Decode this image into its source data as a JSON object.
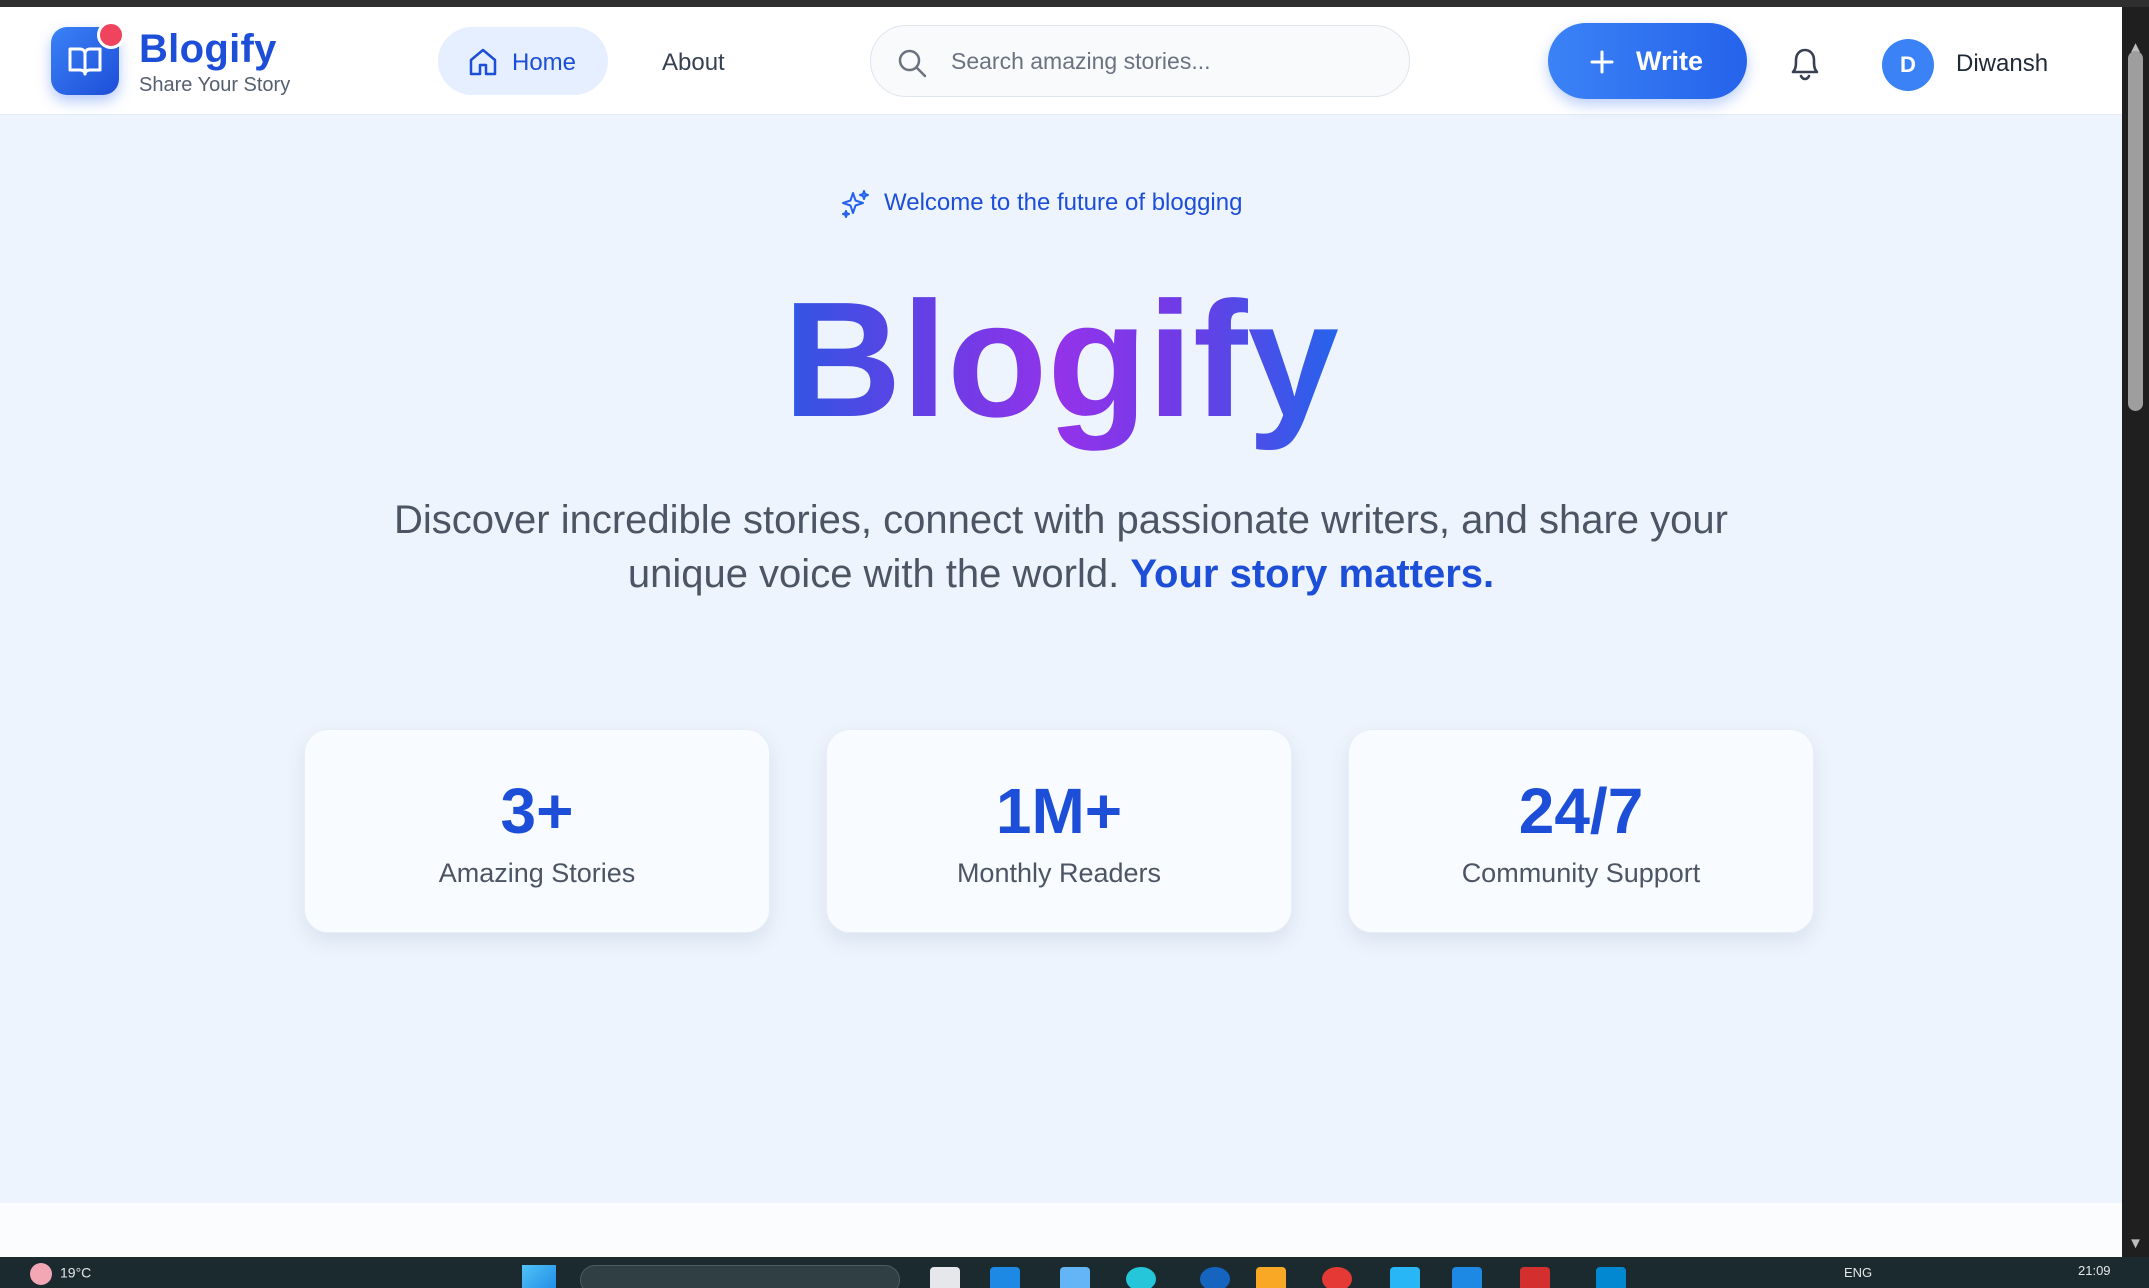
{
  "header": {
    "brand_name": "Blogify",
    "brand_tagline": "Share Your Story",
    "nav": {
      "home_label": "Home",
      "about_label": "About"
    },
    "search": {
      "placeholder": "Search amazing stories...",
      "value": ""
    },
    "write_label": "Write",
    "user": {
      "initial": "D",
      "name": "Diwansh"
    }
  },
  "hero": {
    "badge_text": "Welcome to the future of blogging",
    "title": "Blogify",
    "subtitle_line1": "Discover incredible stories, connect with passionate writers, and share your",
    "subtitle_line2": "unique voice with the world.",
    "subtitle_accent": "Your story matters."
  },
  "stats": [
    {
      "value": "3+",
      "label": "Amazing Stories"
    },
    {
      "value": "1M+",
      "label": "Monthly Readers"
    },
    {
      "value": "24/7",
      "label": "Community Support"
    }
  ],
  "colors": {
    "brand_blue": "#1d4ed8",
    "accent_blue": "#3b82f6",
    "gradient_purple": "#9333ea",
    "notification_dot": "#f0435e",
    "page_background": "#eef4fd"
  },
  "icons": {
    "logo": "open-book-icon",
    "home": "home-icon",
    "search": "search-icon",
    "write": "plus-icon",
    "notifications": "bell-icon",
    "badge": "sparkles-icon"
  },
  "taskbar": {
    "weather": "19°C",
    "language": "ENG",
    "time": "21:09"
  }
}
